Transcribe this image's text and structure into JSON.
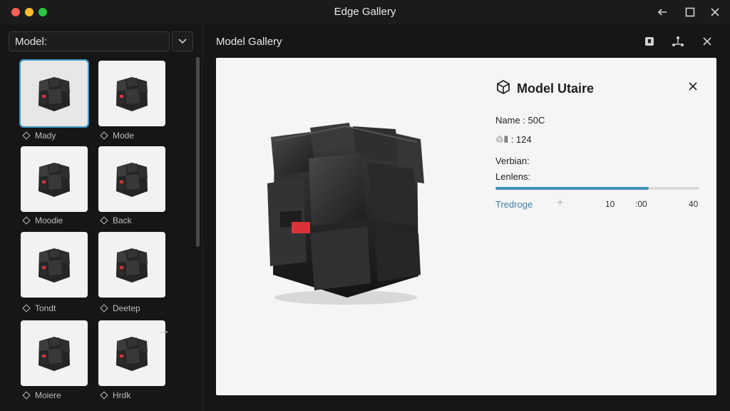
{
  "window": {
    "title": "Edge Gallery"
  },
  "sidebar": {
    "model_label": "Model:",
    "items": [
      {
        "label": "Mady"
      },
      {
        "label": "Mode"
      },
      {
        "label": "Moodie"
      },
      {
        "label": "Back"
      },
      {
        "label": "Tondt"
      },
      {
        "label": "Deetep"
      },
      {
        "label": "Moiere"
      },
      {
        "label": "Hrdk"
      }
    ],
    "more_arrow": "-->"
  },
  "main": {
    "title": "Model Gallery",
    "info": {
      "title": "Model Utaire",
      "name_row": "Name : 50C",
      "icon_row_value": ": 124",
      "icon_row_glyphs": "♲Ⅱ",
      "version_label": "Verbian:",
      "lenses_label": "Lenlens:",
      "progress": 0.75,
      "link": "Tredroge",
      "plus": "+",
      "scale": [
        "10",
        ":00",
        "40"
      ]
    }
  },
  "colors": {
    "accent": "#3f92b8",
    "cube_accent": "#d9333a"
  }
}
